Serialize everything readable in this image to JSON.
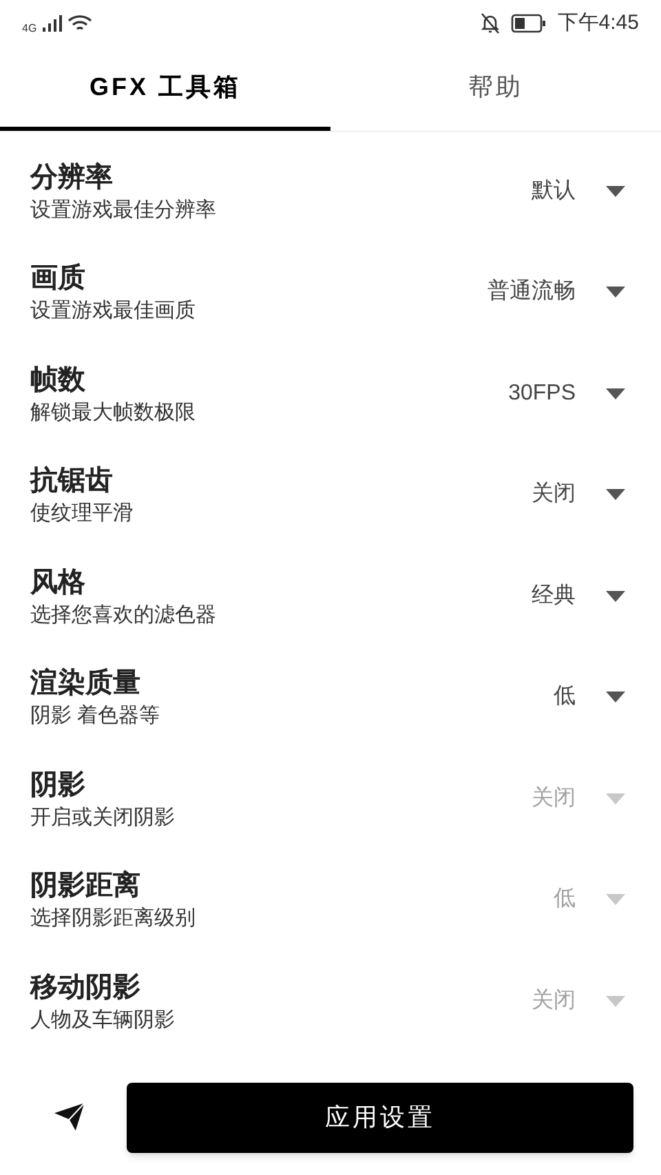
{
  "status_bar": {
    "network": "4G",
    "time": "下午4:45"
  },
  "tabs": [
    {
      "label": "GFX 工具箱",
      "selected": true
    },
    {
      "label": "帮助",
      "selected": false
    }
  ],
  "settings": [
    {
      "title": "分辨率",
      "description": "设置游戏最佳分辨率",
      "value": "默认",
      "disabled": false
    },
    {
      "title": "画质",
      "description": "设置游戏最佳画质",
      "value": "普通流畅",
      "disabled": false
    },
    {
      "title": "帧数",
      "description": "解锁最大帧数极限",
      "value": "30FPS",
      "disabled": false
    },
    {
      "title": "抗锯齿",
      "description": "使纹理平滑",
      "value": "关闭",
      "disabled": false
    },
    {
      "title": "风格",
      "description": "选择您喜欢的滤色器",
      "value": "经典",
      "disabled": false
    },
    {
      "title": "渲染质量",
      "description": "阴影 着色器等",
      "value": "低",
      "disabled": false
    },
    {
      "title": "阴影",
      "description": "开启或关闭阴影",
      "value": "关闭",
      "disabled": true
    },
    {
      "title": "阴影距离",
      "description": "选择阴影距离级别",
      "value": "低",
      "disabled": true
    },
    {
      "title": "移动阴影",
      "description": "人物及车辆阴影",
      "value": "关闭",
      "disabled": true
    }
  ],
  "apply_button": {
    "label": "应用设置"
  }
}
